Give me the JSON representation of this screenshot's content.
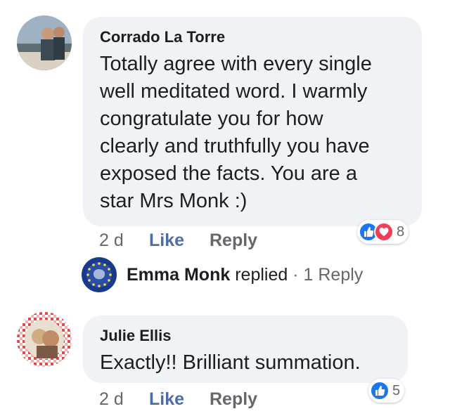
{
  "comments": [
    {
      "author": "Corrado La Torre",
      "text": "Totally agree with every single\nwell meditated word. I warmly\ncongratulate you for how\nclearly and truthfully you have\nexposed the facts. You are a\nstar Mrs Monk :)",
      "time": "2 d",
      "like_label": "Like",
      "reply_label": "Reply",
      "reactions": {
        "icons": [
          "like-icon",
          "love-icon"
        ],
        "count": "8"
      }
    },
    {
      "author": "Julie Ellis",
      "text": "Exactly!! Brilliant summation.",
      "time": "2 d",
      "like_label": "Like",
      "reply_label": "Reply",
      "reactions": {
        "icons": [
          "like-icon"
        ],
        "count": "5"
      }
    }
  ],
  "reply_summary": {
    "name": "Emma Monk",
    "action": "replied",
    "separator": "·",
    "replies": "1 Reply"
  },
  "colors": {
    "bubble": "#f0f2f5",
    "like_blue": "#1877f2",
    "love_red": "#f33e58",
    "meta_gray": "#65676b"
  }
}
